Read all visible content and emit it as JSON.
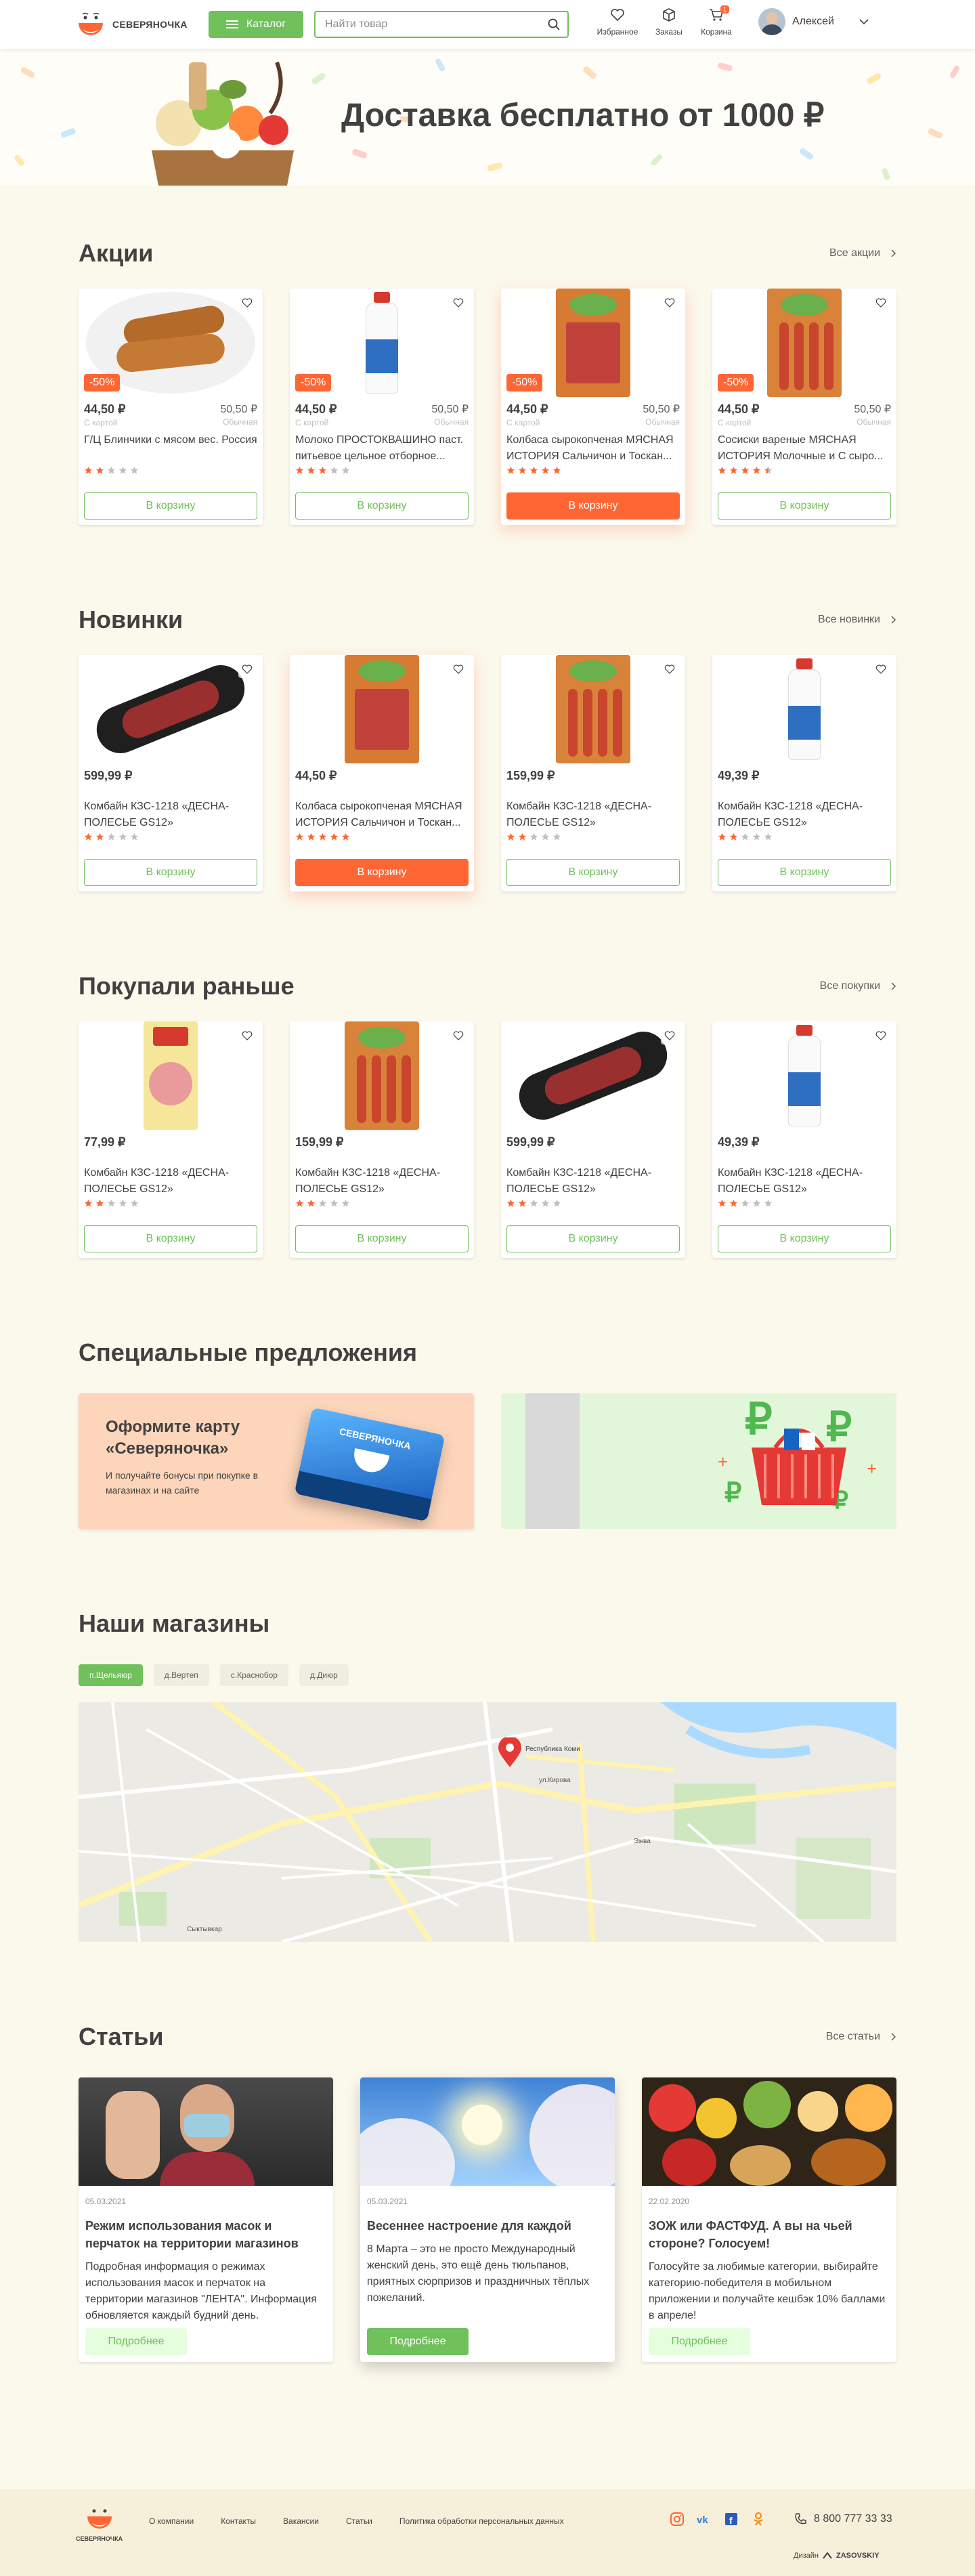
{
  "header": {
    "brand": "СЕВЕРЯНОЧКА",
    "catalog_label": "Каталог",
    "search_placeholder": "Найти товар",
    "nav": [
      {
        "label": "Избранное",
        "icon": "heart-icon"
      },
      {
        "label": "Заказы",
        "icon": "box-icon"
      },
      {
        "label": "Корзина",
        "icon": "cart-icon",
        "badge": "1"
      }
    ],
    "user_name": "Алексей"
  },
  "banner": {
    "title": "Доставка бесплатно от 1000 ₽"
  },
  "promo": {
    "title": "Акции",
    "link": "Все акции",
    "products": [
      {
        "price": "44,50 ₽",
        "price_label": "С картой",
        "old_price": "50,50 ₽",
        "old_label": "Обычная",
        "discount": "-50%",
        "name": "Г/Ц Блинчики с мясом вес. Россия",
        "rating": 2,
        "button": "В корзину",
        "active": false,
        "image": "pancakes"
      },
      {
        "price": "44,50 ₽",
        "price_label": "С картой",
        "old_price": "50,50 ₽",
        "old_label": "Обычная",
        "discount": "-50%",
        "name": "Молоко ПРОСТОКВАШИНО паст. питьевое цельное отборное...",
        "rating": 3,
        "button": "В корзину",
        "active": false,
        "image": "milk"
      },
      {
        "price": "44,50 ₽",
        "price_label": "С картой",
        "old_price": "50,50 ₽",
        "old_label": "Обычная",
        "discount": "-50%",
        "name": "Колбаса сырокопченая МЯСНАЯ ИСТОРИЯ Сальчичон и Тоскан...",
        "rating": 5,
        "button": "В корзину",
        "active": true,
        "image": "pack-salami"
      },
      {
        "price": "44,50 ₽",
        "price_label": "С картой",
        "old_price": "50,50 ₽",
        "old_label": "Обычная",
        "discount": "-50%",
        "name": "Сосиски вареные МЯСНАЯ ИСТОРИЯ Молочные и С сыро...",
        "rating": 4.5,
        "button": "В корзину",
        "active": false,
        "image": "pack-sausages"
      }
    ]
  },
  "new": {
    "title": "Новинки",
    "link": "Все новинки",
    "products": [
      {
        "price": "599,99 ₽",
        "name": "Комбайн КЗС-1218 «ДЕСНА-ПОЛЕСЬЕ GS12»",
        "rating": 2,
        "button": "В корзину",
        "active": false,
        "image": "salami"
      },
      {
        "price": "44,50 ₽",
        "name": "Колбаса сырокопченая МЯСНАЯ ИСТОРИЯ Сальчичон и Тоскан...",
        "rating": 5,
        "button": "В корзину",
        "active": true,
        "image": "pack-salami"
      },
      {
        "price": "159,99 ₽",
        "name": "Комбайн КЗС-1218 «ДЕСНА-ПОЛЕСЬЕ GS12»",
        "rating": 2,
        "button": "В корзину",
        "active": false,
        "image": "pack-sausages"
      },
      {
        "price": "49,39 ₽",
        "name": "Комбайн КЗС-1218 «ДЕСНА-ПОЛЕСЬЕ GS12»",
        "rating": 2,
        "button": "В корзину",
        "active": false,
        "image": "milk"
      }
    ]
  },
  "bought": {
    "title": "Покупали раньше",
    "link": "Все покупки",
    "products": [
      {
        "price": "77,99 ₽",
        "name": "Комбайн КЗС-1218 «ДЕСНА-ПОЛЕСЬЕ GS12»",
        "rating": 2,
        "button": "В корзину",
        "active": false,
        "image": "ham"
      },
      {
        "price": "159,99 ₽",
        "name": "Комбайн КЗС-1218 «ДЕСНА-ПОЛЕСЬЕ GS12»",
        "rating": 2,
        "button": "В корзину",
        "active": false,
        "image": "pack-sausages"
      },
      {
        "price": "599,99 ₽",
        "name": "Комбайн КЗС-1218 «ДЕСНА-ПОЛЕСЬЕ GS12»",
        "rating": 2,
        "button": "В корзину",
        "active": false,
        "image": "salami"
      },
      {
        "price": "49,39 ₽",
        "name": "Комбайн КЗС-1218 «ДЕСНА-ПОЛЕСЬЕ GS12»",
        "rating": 2,
        "button": "В корзину",
        "active": false,
        "image": "milk"
      }
    ]
  },
  "special": {
    "title": "Специальные предложения",
    "card_title": "Оформите карту «Северяночка»",
    "card_text": "И получайте бонусы при покупке в магазинах и на сайте",
    "card_brand": "СЕВЕРЯНОЧКА"
  },
  "shops": {
    "title": "Наши магазины",
    "tabs": [
      "п.Щельяюр",
      "д.Вертеп",
      "с.Краснобор",
      "д.Диюр"
    ],
    "active_tab": 0,
    "map_pin_label": "Республика Коми",
    "map_labels": [
      "Сыктывкар",
      "ул.Кирова",
      "Эжва"
    ]
  },
  "articles": {
    "title": "Статьи",
    "link": "Все статьи",
    "items": [
      {
        "date": "05.03.2021",
        "title": "Режим использования масок и перчаток на территории магазинов",
        "text": "Подробная информация о режимах использования масок и перчаток на территории магазинов \"ЛЕНТА\". Информация обновляется каждый будний день.",
        "button": "Подробнее",
        "active": false,
        "image": "mask"
      },
      {
        "date": "05.03.2021",
        "title": "Весеннее настроение для каждой",
        "text": "8 Марта – это не просто Международный женский день, это ещё день тюльпанов, приятных сюрпризов и праздничных тёплых пожеланий.",
        "button": "Подробнее",
        "active": true,
        "image": "spring"
      },
      {
        "date": "22.02.2020",
        "title": "ЗОЖ или ФАСТФУД. А вы на чьей стороне? Голосуем!",
        "text": "Голосуйте за любимые категории, выбирайте категорию-победителя в мобильном приложении и получайте кешбэк 10% баллами в апреле!",
        "button": "Подробнее",
        "active": false,
        "image": "food"
      }
    ]
  },
  "footer": {
    "brand": "СЕВЕРЯНОЧКА",
    "links": [
      "О компании",
      "Контакты",
      "Вакансии",
      "Статьи",
      "Политика обработки персональных данных"
    ],
    "social": [
      "instagram-icon",
      "vk-icon",
      "facebook-icon",
      "odnoklassniki-icon"
    ],
    "phone": "8 800 777 33 33",
    "design_label": "Дизайн",
    "design_studio": "ZASOVSKIY"
  },
  "colors": {
    "accent": "#70c05b",
    "orange": "#ff6633",
    "background": "#fbf8ec",
    "text": "#414141"
  }
}
